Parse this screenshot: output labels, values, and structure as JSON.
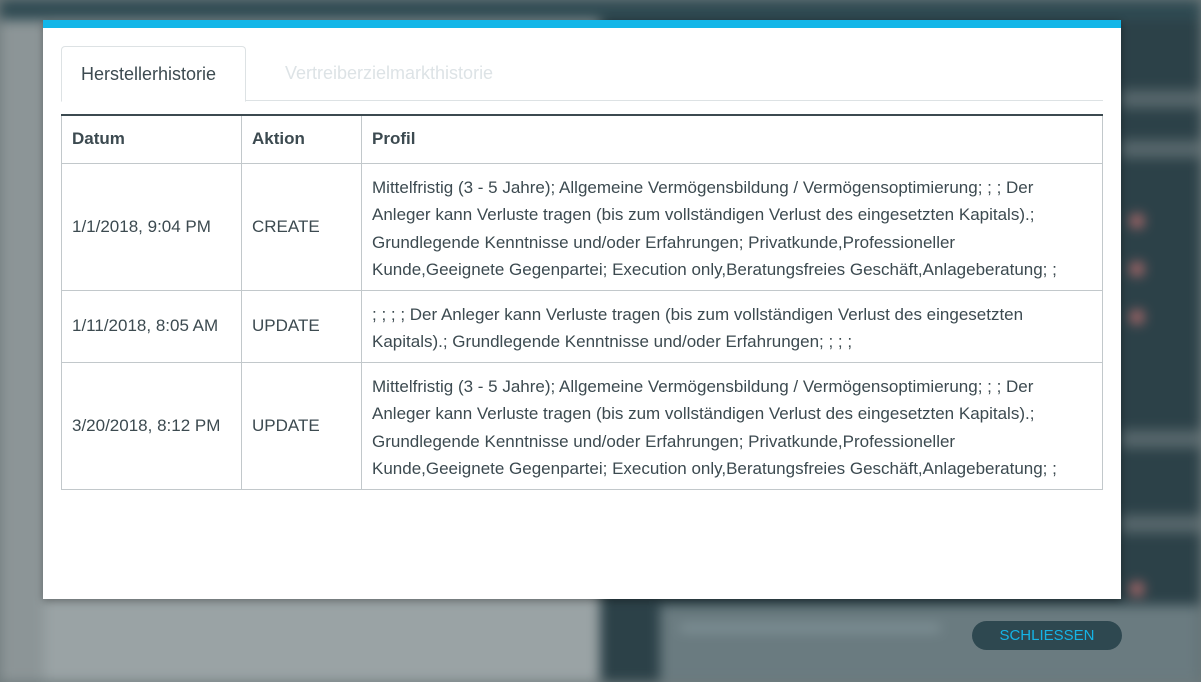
{
  "tabs": [
    {
      "label": "Herstellerhistorie"
    },
    {
      "label": "Vertreiberzielmarkthistorie"
    }
  ],
  "table": {
    "headers": [
      "Datum",
      "Aktion",
      "Profil"
    ],
    "rows": [
      {
        "datum": "1/1/2018, 9:04 PM",
        "aktion": "CREATE",
        "profil": "Mittelfristig (3 - 5 Jahre); Allgemeine Vermögensbildung / Vermögensoptimierung; ; ; Der Anleger kann Verluste tragen (bis zum vollständigen Verlust des eingesetzten Kapitals).; Grundlegende Kenntnisse und/oder Erfahrungen; Privatkunde,Professioneller Kunde,Geeignete Gegenpartei; Execution only,Beratungsfreies Geschäft,Anlageberatung; ;"
      },
      {
        "datum": "1/11/2018, 8:05 AM",
        "aktion": "UPDATE",
        "profil": "; ; ; ; Der Anleger kann Verluste tragen (bis zum vollständigen Verlust des eingesetzten Kapitals).; Grundlegende Kenntnisse und/oder Erfahrungen; ; ; ;"
      },
      {
        "datum": "3/20/2018, 8:12 PM",
        "aktion": "UPDATE",
        "profil": "Mittelfristig (3 - 5 Jahre); Allgemeine Vermögensbildung / Vermögensoptimierung; ; ; Der Anleger kann Verluste tragen (bis zum vollständigen Verlust des eingesetzten Kapitals).; Grundlegende Kenntnisse und/oder Erfahrungen; Privatkunde,Professioneller Kunde,Geeignete Gegenpartei; Execution only,Beratungsfreies Geschäft,Anlageberatung; ;"
      }
    ]
  },
  "close_button": {
    "label": "SCHLIESSEN"
  },
  "colors": {
    "accent": "#13b6e8",
    "button_bg": "#2e4850",
    "text": "#3c4a50"
  }
}
